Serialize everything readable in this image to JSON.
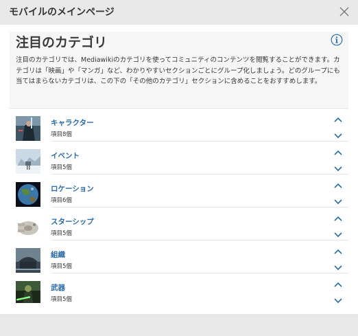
{
  "modal": {
    "title": "モバイルのメインページ"
  },
  "section": {
    "title": "注目のカテゴリ",
    "description": "注目のカテゴリでは、Mediawikiのカテゴリを使ってコミュニティのコンテンツを閲覧することができます。カテゴリは「映画」や「マンガ」など、わかりやすいセクションごとにグループ化しましょう。どのグループにも当てはまらないカテゴリは、この下の「その他のカテゴリ」セクションに含めることをおすすめします。"
  },
  "colors": {
    "link": "#2a6aa8",
    "header_bg": "#e9e9e9",
    "section_bg": "#f6f6f6",
    "page_bg": "#e8e8e8"
  },
  "categories": [
    {
      "name": "キャラクター",
      "count": "項目8個",
      "thumb": "character-thumb"
    },
    {
      "name": "イベント",
      "count": "項目5個",
      "thumb": "event-thumb"
    },
    {
      "name": "ロケーション",
      "count": "項目6個",
      "thumb": "location-thumb"
    },
    {
      "name": "スターシップ",
      "count": "項目5個",
      "thumb": "starship-thumb"
    },
    {
      "name": "組織",
      "count": "項目5個",
      "thumb": "organization-thumb"
    },
    {
      "name": "武器",
      "count": "項目5個",
      "thumb": "weapon-thumb"
    }
  ],
  "icons": {
    "close": "close-icon",
    "info": "info-icon",
    "up": "chevron-up-icon",
    "down": "chevron-down-icon"
  }
}
